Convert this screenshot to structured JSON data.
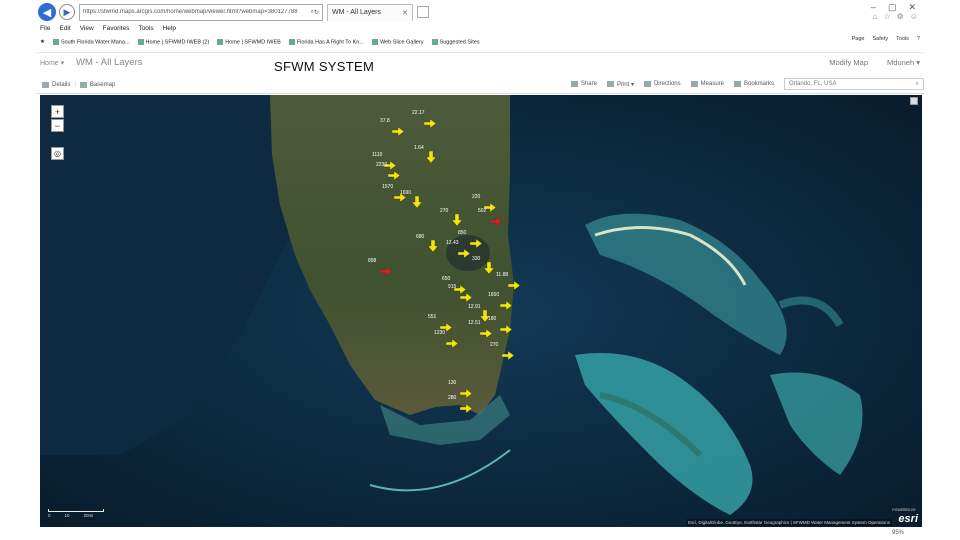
{
  "browser": {
    "address": "https://sfwmd.maps.arcgis.com/home/webmap/viewer.html?webmap=380127788",
    "tab_title": "WM - All Layers",
    "menu": [
      "File",
      "Edit",
      "View",
      "Favorites",
      "Tools",
      "Help"
    ],
    "favorites": [
      "South Florida Water Mana...",
      "Home | SFWMD IWEB (2)",
      "Home | SFWMD IWEB",
      "Florida Has A Right To Kn...",
      "Web Slice Gallery",
      "Suggested Sites"
    ],
    "command_bar": [
      "Page",
      "Safety",
      "Tools"
    ],
    "window_controls": [
      "–",
      "▢",
      "✕"
    ],
    "zoom_level": "95%"
  },
  "app": {
    "home_label": "Home ▾",
    "map_title": "WM - All Layers",
    "slide_title": "SFWM SYSTEM",
    "modify_map": "Modify Map",
    "user": "Mduneh ▾"
  },
  "toolbar": {
    "details": "Details",
    "basemap": "Basemap",
    "share": "Share",
    "print": "Print ▾",
    "directions": "Directions",
    "measure": "Measure",
    "bookmarks": "Bookmarks",
    "search_value": "Orlando, FL, USA"
  },
  "map": {
    "zoom_in": "+",
    "zoom_out": "−",
    "scale_labels": [
      "0",
      "10",
      "20mi"
    ],
    "attribution": "Esri, DigitalGlobe, GeoEye, Earthstar Geographics | SFWMD Water Management System Operations",
    "powered_by": "POWERED BY",
    "logo": "esri",
    "markers": [
      {
        "label": "22.17",
        "color": "yellow"
      },
      {
        "label": "37.8",
        "color": "yellow"
      },
      {
        "label": "1.64",
        "color": "yellow"
      },
      {
        "label": "1110",
        "color": "yellow"
      },
      {
        "label": "2230",
        "color": "yellow"
      },
      {
        "label": "1570",
        "color": "yellow"
      },
      {
        "label": "1690",
        "color": "yellow"
      },
      {
        "label": "220",
        "color": "yellow"
      },
      {
        "label": "502",
        "color": "red"
      },
      {
        "label": "270",
        "color": "yellow"
      },
      {
        "label": "680",
        "color": "yellow"
      },
      {
        "label": "850",
        "color": "yellow"
      },
      {
        "label": "12.43",
        "color": "yellow"
      },
      {
        "label": "898",
        "color": "red"
      },
      {
        "label": "330",
        "color": "yellow"
      },
      {
        "label": "11.88",
        "color": "yellow"
      },
      {
        "label": "650",
        "color": "yellow"
      },
      {
        "label": "915",
        "color": "yellow"
      },
      {
        "label": "1650",
        "color": "yellow"
      },
      {
        "label": "12.91",
        "color": "yellow"
      },
      {
        "label": "551",
        "color": "yellow"
      },
      {
        "label": "1230",
        "color": "yellow"
      },
      {
        "label": "12.51",
        "color": "yellow"
      },
      {
        "label": "180",
        "color": "yellow"
      },
      {
        "label": "270",
        "color": "yellow"
      },
      {
        "label": "130",
        "color": "yellow"
      },
      {
        "label": "280",
        "color": "yellow"
      }
    ]
  },
  "colors": {
    "marker_yellow": "#f5e600",
    "marker_red": "#d62020",
    "ocean": "#0a2032"
  }
}
